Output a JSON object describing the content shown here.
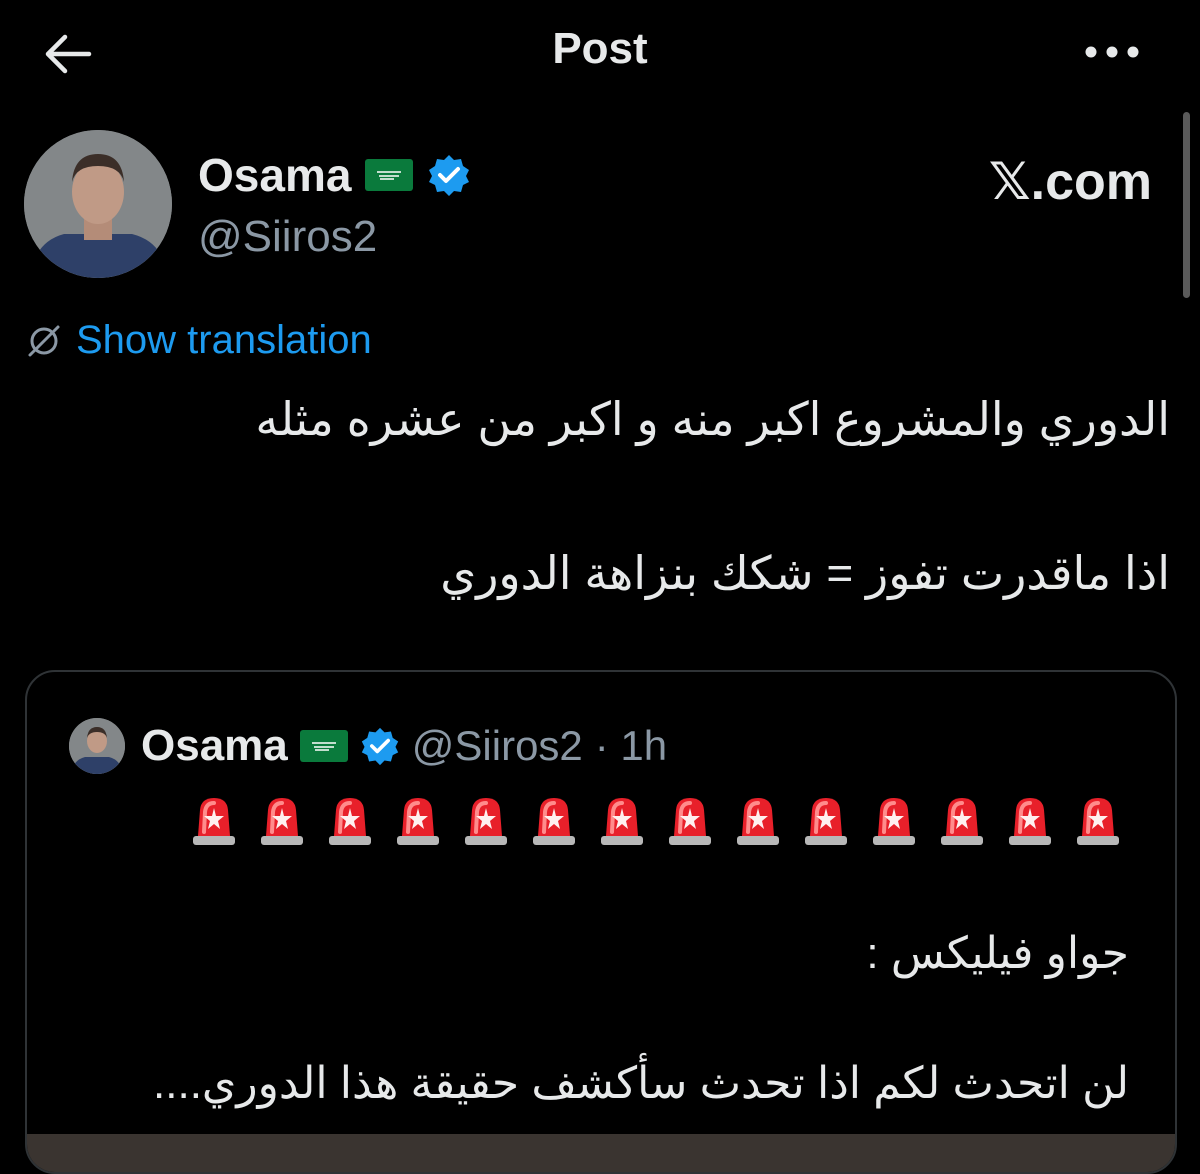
{
  "header": {
    "title": "Post",
    "back_icon": "arrow-left-icon",
    "more_icon": "more-horizontal-icon"
  },
  "post": {
    "display_name": "Osama",
    "handle": "@Siiros2",
    "flag_icon": "saudi-flag-icon",
    "verified_icon": "verified-badge-icon",
    "watermark": "𝕏.com",
    "show_translation": "Show translation",
    "text_lines": [
      "الدوري والمشروع اكبر منه و اكبر من عشره مثله",
      "اذا ماقدرت تفوز = شكك بنزاهة الدوري"
    ]
  },
  "quote": {
    "display_name": "Osama",
    "handle": "@Siiros2",
    "time": "· 1h",
    "siren_count": 14,
    "siren_icon": "police-siren-icon",
    "text_lines": [
      "جواو فيليكس :",
      "لن اتحدث لكم اذا تحدث سأكشف حقيقة هذا الدوري...."
    ]
  },
  "colors": {
    "background": "#000000",
    "link": "#1d9bf0",
    "verified": "#1d9bf0",
    "muted": "#8b98a5",
    "border": "#2f3336"
  }
}
